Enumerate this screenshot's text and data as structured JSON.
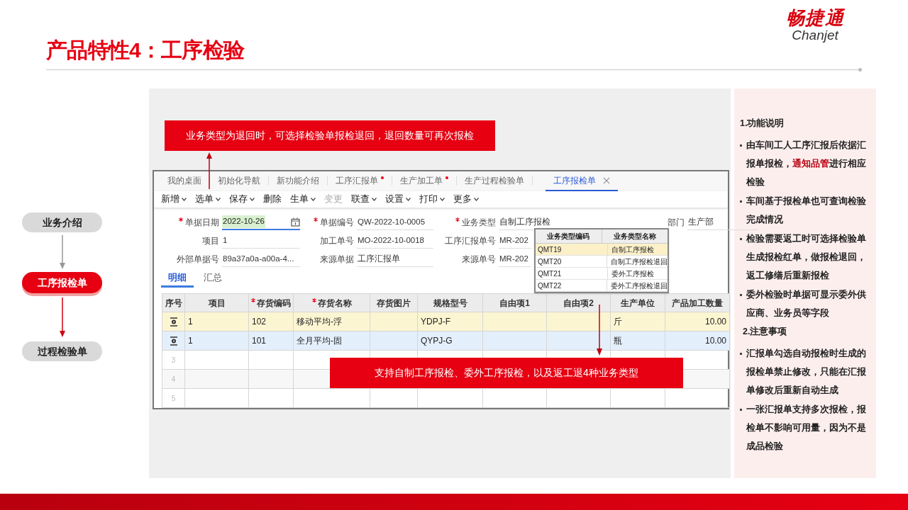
{
  "slide_title": "产品特性4：工序检验",
  "logo": {
    "name": "畅捷通",
    "latin": "Chanjet"
  },
  "flow": [
    {
      "label": "业务介绍",
      "selected": false
    },
    {
      "label": "工序报检单",
      "selected": true
    },
    {
      "label": "过程检验单",
      "selected": false
    }
  ],
  "callouts": [
    "业务类型为退回时，可选择检验单报检退回，退回数量可再次报检",
    "支持自制工序报检、委外工序报检，以及返工退4种业务类型"
  ],
  "app": {
    "tabs": [
      {
        "label": "我的桌面",
        "selected": false,
        "modified": false
      },
      {
        "label": "初始化导航",
        "selected": false,
        "modified": false
      },
      {
        "label": "新功能介绍",
        "selected": false,
        "modified": false
      },
      {
        "label": "工序汇报单",
        "selected": false,
        "modified": true
      },
      {
        "label": "生产加工单",
        "selected": false,
        "modified": true
      },
      {
        "label": "生产过程检验单",
        "selected": false,
        "modified": false
      },
      {
        "label": "工序报检单",
        "selected": true,
        "modified": false
      }
    ],
    "toolbar": [
      {
        "label": "新增",
        "dropdown": true,
        "disabled": false
      },
      {
        "label": "选单",
        "dropdown": true,
        "disabled": false
      },
      {
        "label": "保存",
        "dropdown": true,
        "disabled": false
      },
      {
        "label": "删除",
        "dropdown": false,
        "disabled": false
      },
      {
        "label": "生单",
        "dropdown": true,
        "disabled": false
      },
      {
        "label": "变更",
        "dropdown": false,
        "disabled": true
      },
      {
        "label": "联查",
        "dropdown": true,
        "disabled": false
      },
      {
        "label": "设置",
        "dropdown": true,
        "disabled": false
      },
      {
        "label": "打印",
        "dropdown": true,
        "disabled": false
      },
      {
        "label": "更多",
        "dropdown": true,
        "disabled": false
      }
    ],
    "form": [
      [
        {
          "label": "单据日期",
          "value": "2022-10-26",
          "required": true,
          "focused": true,
          "kind": "date"
        },
        {
          "label": "单据编号",
          "value": "QW-2022-10-0005",
          "required": true,
          "focused": false,
          "kind": "text"
        },
        {
          "label": "业务类型",
          "value": "自制工序报检",
          "required": true,
          "focused": false,
          "kind": "text"
        },
        {
          "label": "部门",
          "value": "生产部",
          "required": false,
          "focused": false,
          "kind": "text"
        }
      ],
      [
        {
          "label": "项目",
          "value": "1",
          "required": false,
          "focused": false,
          "kind": "text"
        },
        {
          "label": "加工单号",
          "value": "MO-2022-10-0018",
          "required": false,
          "focused": false,
          "kind": "text"
        },
        {
          "label": "工序汇报单号",
          "value": "MR-202",
          "required": false,
          "focused": false,
          "kind": "text"
        }
      ],
      [
        {
          "label": "外部单据号",
          "value": "89a37a0a-a00a-4...",
          "required": false,
          "focused": false,
          "kind": "text"
        },
        {
          "label": "来源单据",
          "value": "工序汇报单",
          "required": false,
          "focused": false,
          "kind": "text"
        },
        {
          "label": "来源单号",
          "value": "MR-202",
          "required": false,
          "focused": false,
          "kind": "text"
        }
      ]
    ],
    "subtabs": [
      {
        "label": "明细",
        "selected": true
      },
      {
        "label": "汇总",
        "selected": false
      }
    ],
    "table": {
      "columns": [
        {
          "label": "序号",
          "required": false
        },
        {
          "label": "项目",
          "required": false
        },
        {
          "label": "存货编码",
          "required": true
        },
        {
          "label": "存货名称",
          "required": true
        },
        {
          "label": "存货图片",
          "required": false
        },
        {
          "label": "规格型号",
          "required": false
        },
        {
          "label": "自由项1",
          "required": false
        },
        {
          "label": "自由项2",
          "required": false
        },
        {
          "label": "生产单位",
          "required": false
        },
        {
          "label": "产品加工数量",
          "required": false
        }
      ],
      "rows": [
        {
          "kind": "data",
          "color": "#fcf5d2",
          "cells": [
            "1",
            "102",
            "移动平均-浮",
            "",
            "YDPJ-F",
            "",
            "",
            "斤",
            "10.00"
          ]
        },
        {
          "kind": "data",
          "color": "#e4effc",
          "cells": [
            "1",
            "101",
            "全月平均-固",
            "",
            "QYPJ-G",
            "",
            "",
            "瓶",
            "10.00"
          ]
        },
        {
          "kind": "empty",
          "index": "3"
        },
        {
          "kind": "empty",
          "index": "4"
        },
        {
          "kind": "empty",
          "index": "5"
        }
      ]
    },
    "dropdown": {
      "columns": [
        "业务类型编码",
        "业务类型名称"
      ],
      "rows": [
        {
          "code": "QMT19",
          "name": "自制工序报检",
          "selected": true
        },
        {
          "code": "QMT20",
          "name": "自制工序报检退回",
          "selected": false
        },
        {
          "code": "QMT21",
          "name": "委外工序报检",
          "selected": false
        },
        {
          "code": "QMT22",
          "name": "委外工序报检退回",
          "selected": false
        }
      ]
    }
  },
  "notes": [
    {
      "heading": "1.功能说明",
      "bullets": [
        "由车间工人工序汇报后依据汇报单报检，**通知品管**进行相应检验",
        "车间基于报检单也可查询检验完成情况",
        "检验需要返工时可选择检验单生成报检红单，做报检退回，返工修缮后重新报检",
        "委外检验时单据可显示委外供应商、业务员等字段"
      ]
    },
    {
      "heading": "2.注意事项",
      "bullets": [
        "汇报单勾选自动报检时生成的报检单禁止修改，只能在汇报单修改后重新自动生成",
        "一张汇报单支持多次报检，报检单不影响可用量，因为不是成品检验"
      ]
    }
  ]
}
